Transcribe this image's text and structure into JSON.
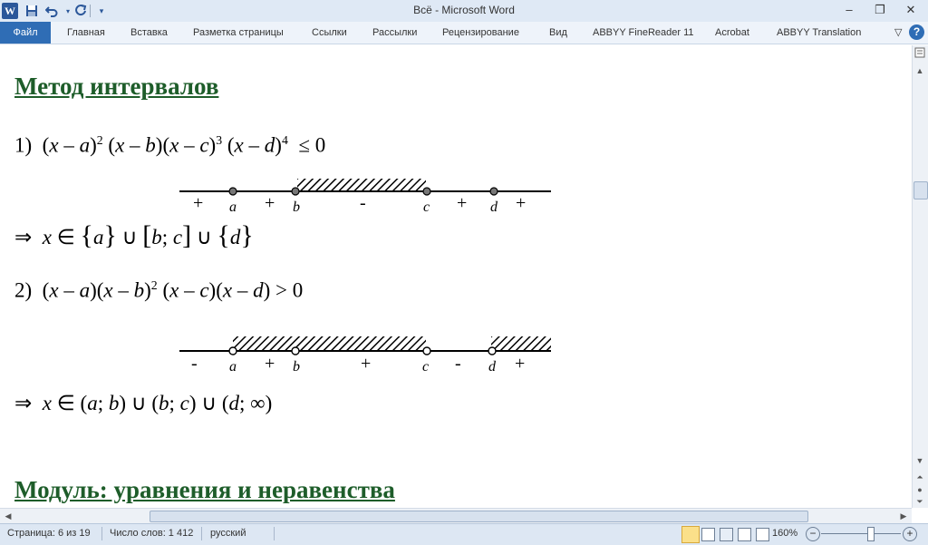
{
  "window": {
    "title": "Всё  -  Microsoft Word",
    "word_icon": "W",
    "qa": {
      "save": "save-icon",
      "undo": "undo-icon",
      "redo": "redo-icon",
      "customize": "customize-icon"
    },
    "controls": {
      "minimize": "–",
      "restore": "❐",
      "close": "✕"
    }
  },
  "ribbon": {
    "file_tab": "Файл",
    "tabs": [
      "Главная",
      "Вставка",
      "Разметка страницы",
      "Ссылки",
      "Рассылки",
      "Рецензирование",
      "Вид",
      "ABBYY FineReader 11",
      "Acrobat",
      "ABBYY Translation"
    ],
    "collapse_icon": "▽",
    "help_icon": "?"
  },
  "document": {
    "heading1": "Метод интервалов",
    "heading2": "Модуль: уравнения и неравенства",
    "ex1": {
      "num": "1)",
      "rel": "≤ 0",
      "signs": [
        "+",
        "+",
        "-",
        "+",
        "+"
      ],
      "points": [
        "a",
        "b",
        "c",
        "d"
      ]
    },
    "ex2": {
      "num": "2)",
      "rel": "> 0",
      "signs": [
        "-",
        "+",
        "+",
        "-",
        "+"
      ],
      "points": [
        "a",
        "b",
        "c",
        "d"
      ]
    },
    "implies": "⇒",
    "infinity": "∞"
  },
  "status": {
    "page": "Страница: 6 из 19",
    "words": "Число слов: 1 412",
    "language": "русский",
    "zoom": "160%",
    "zoom_minus": "−",
    "zoom_plus": "+"
  },
  "colors": {
    "heading": "#1e5d2a",
    "file_tab": "#2f6db5"
  }
}
